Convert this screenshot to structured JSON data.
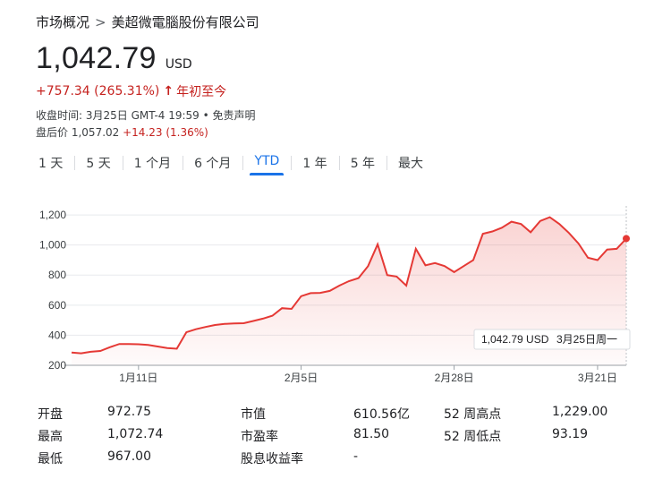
{
  "breadcrumb": {
    "root": "市场概况",
    "separator": ">",
    "company": "美超微電腦股份有限公司"
  },
  "quote": {
    "price": "1,042.79",
    "currency": "USD",
    "change": "+757.34 (265.31%)",
    "change_arrow": "↑",
    "period": "年初至今",
    "close_time_label": "收盘时间: 3月25日 GMT-4 19:59",
    "disclaimer": "免责声明",
    "after_hours_label": "盘后价",
    "after_hours_price": "1,057.02",
    "after_hours_change": "+14.23 (1.36%)"
  },
  "tabs": [
    {
      "label": "1 天",
      "active": false
    },
    {
      "label": "5 天",
      "active": false
    },
    {
      "label": "1 个月",
      "active": false
    },
    {
      "label": "6 个月",
      "active": false
    },
    {
      "label": "YTD",
      "active": true
    },
    {
      "label": "1 年",
      "active": false
    },
    {
      "label": "5 年",
      "active": false
    },
    {
      "label": "最大",
      "active": false
    }
  ],
  "colors": {
    "line": "#e53935",
    "accent": "#1a73e8",
    "negative": "#c5221f"
  },
  "chart_data": {
    "type": "area",
    "ylim": [
      200,
      1260
    ],
    "yticks": [
      "1,200",
      "1,000",
      "800",
      "600",
      "400",
      "200"
    ],
    "ytick_values": [
      1200,
      1000,
      800,
      600,
      400,
      200
    ],
    "xticks": [
      "1月11日",
      "2月5日",
      "2月28日",
      "3月21日"
    ],
    "xtick_positions": [
      7,
      24,
      40,
      55
    ],
    "x_count": 57,
    "values": [
      285,
      280,
      290,
      295,
      320,
      342,
      342,
      340,
      335,
      325,
      315,
      310,
      420,
      440,
      455,
      468,
      475,
      478,
      480,
      495,
      510,
      530,
      580,
      575,
      660,
      680,
      682,
      695,
      730,
      760,
      780,
      860,
      1005,
      800,
      790,
      730,
      975,
      865,
      880,
      860,
      820,
      860,
      900,
      1075,
      1090,
      1115,
      1155,
      1140,
      1085,
      1160,
      1185,
      1140,
      1080,
      1010,
      915,
      900,
      970,
      975,
      1042.79
    ],
    "tooltip": {
      "price": "1,042.79 USD",
      "date": "3月25日周一"
    }
  },
  "stats": [
    {
      "label": "开盘",
      "value": "972.75"
    },
    {
      "label": "最高",
      "value": "1,072.74"
    },
    {
      "label": "最低",
      "value": "967.00"
    },
    {
      "label": "市值",
      "value": "610.56亿"
    },
    {
      "label": "市盈率",
      "value": "81.50"
    },
    {
      "label": "股息收益率",
      "value": "-"
    },
    {
      "label": "52 周高点",
      "value": "1,229.00"
    },
    {
      "label": "52 周低点",
      "value": "93.19"
    }
  ]
}
